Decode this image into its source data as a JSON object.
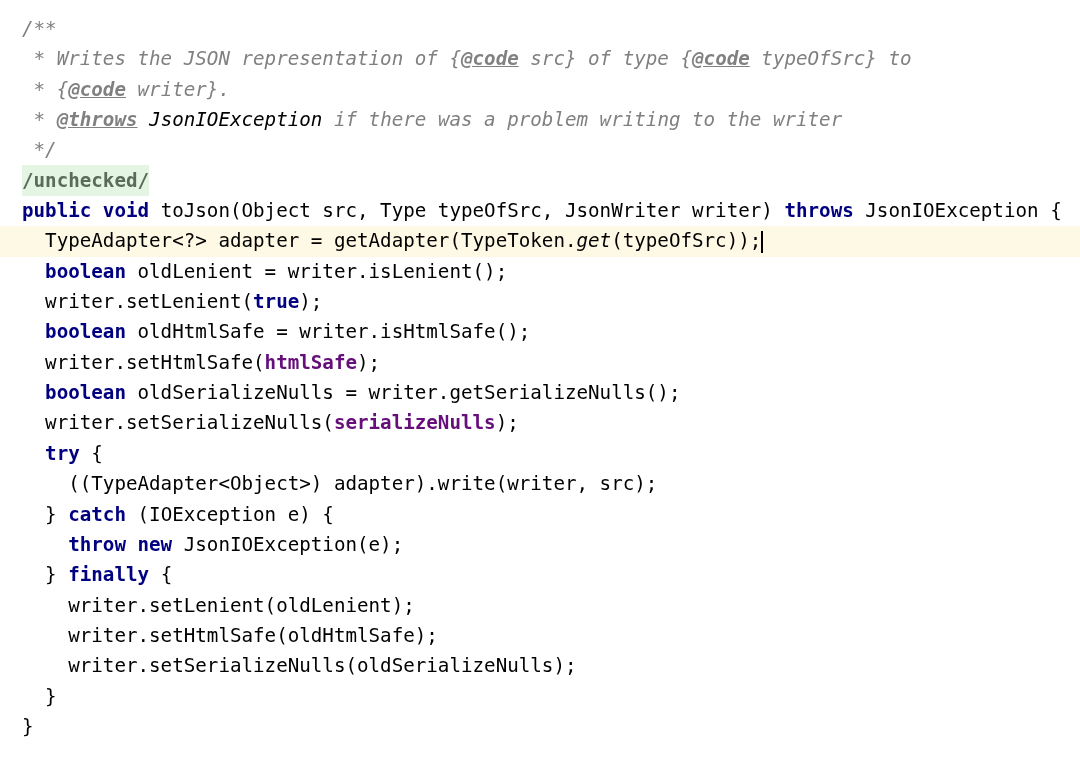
{
  "editor": {
    "lines": [
      {
        "current": false,
        "tokens": [
          {
            "kind": "comment",
            "text": "/**"
          }
        ]
      },
      {
        "current": false,
        "tokens": [
          {
            "kind": "comment",
            "text": " * Writes the JSON representation of {"
          },
          {
            "kind": "doctag",
            "text": "@code"
          },
          {
            "kind": "comment",
            "text": " src} of type {"
          },
          {
            "kind": "doctag",
            "text": "@code"
          },
          {
            "kind": "comment",
            "text": " typeOfSrc} to"
          }
        ]
      },
      {
        "current": false,
        "tokens": [
          {
            "kind": "comment",
            "text": " * {"
          },
          {
            "kind": "doctag",
            "text": "@code"
          },
          {
            "kind": "comment",
            "text": " writer}."
          }
        ]
      },
      {
        "current": false,
        "tokens": [
          {
            "kind": "comment",
            "text": " * "
          },
          {
            "kind": "doctag",
            "text": "@throws"
          },
          {
            "kind": "docref",
            "text": " JsonIOException"
          },
          {
            "kind": "comment",
            "text": " if there was a problem writing to the writer"
          }
        ]
      },
      {
        "current": false,
        "tokens": [
          {
            "kind": "comment",
            "text": " */"
          }
        ]
      },
      {
        "current": false,
        "tokens": [
          {
            "kind": "folded",
            "text": "/unchecked/"
          }
        ]
      },
      {
        "current": false,
        "tokens": [
          {
            "kind": "keyword",
            "text": "public void"
          },
          {
            "kind": "plain",
            "text": " toJson(Object src, Type typeOfSrc, JsonWriter writer) "
          },
          {
            "kind": "keyword",
            "text": "throws"
          },
          {
            "kind": "plain",
            "text": " JsonIOException {"
          }
        ]
      },
      {
        "current": true,
        "tokens": [
          {
            "kind": "plain",
            "text": "  TypeAdapter<?> adapter = getAdapter(TypeToken."
          },
          {
            "kind": "italic",
            "text": "get"
          },
          {
            "kind": "plain",
            "text": "(typeOfSrc));"
          }
        ]
      },
      {
        "current": false,
        "tokens": [
          {
            "kind": "keyword",
            "text": "  boolean"
          },
          {
            "kind": "plain",
            "text": " oldLenient = writer.isLenient();"
          }
        ]
      },
      {
        "current": false,
        "tokens": [
          {
            "kind": "plain",
            "text": "  writer.setLenient("
          },
          {
            "kind": "keyword",
            "text": "true"
          },
          {
            "kind": "plain",
            "text": ");"
          }
        ]
      },
      {
        "current": false,
        "tokens": [
          {
            "kind": "keyword",
            "text": "  boolean"
          },
          {
            "kind": "plain",
            "text": " oldHtmlSafe = writer.isHtmlSafe();"
          }
        ]
      },
      {
        "current": false,
        "tokens": [
          {
            "kind": "plain",
            "text": "  writer.setHtmlSafe("
          },
          {
            "kind": "field",
            "text": "htmlSafe"
          },
          {
            "kind": "plain",
            "text": ");"
          }
        ]
      },
      {
        "current": false,
        "tokens": [
          {
            "kind": "keyword",
            "text": "  boolean"
          },
          {
            "kind": "plain",
            "text": " oldSerializeNulls = writer.getSerializeNulls();"
          }
        ]
      },
      {
        "current": false,
        "tokens": [
          {
            "kind": "plain",
            "text": "  writer.setSerializeNulls("
          },
          {
            "kind": "field",
            "text": "serializeNulls"
          },
          {
            "kind": "plain",
            "text": ");"
          }
        ]
      },
      {
        "current": false,
        "tokens": [
          {
            "kind": "keyword",
            "text": "  try"
          },
          {
            "kind": "plain",
            "text": " {"
          }
        ]
      },
      {
        "current": false,
        "tokens": [
          {
            "kind": "plain",
            "text": "    ((TypeAdapter<Object>) adapter).write(writer, src);"
          }
        ]
      },
      {
        "current": false,
        "tokens": [
          {
            "kind": "plain",
            "text": "  } "
          },
          {
            "kind": "keyword",
            "text": "catch"
          },
          {
            "kind": "plain",
            "text": " (IOException e) {"
          }
        ]
      },
      {
        "current": false,
        "tokens": [
          {
            "kind": "keyword",
            "text": "    throw new"
          },
          {
            "kind": "plain",
            "text": " JsonIOException(e);"
          }
        ]
      },
      {
        "current": false,
        "tokens": [
          {
            "kind": "plain",
            "text": "  } "
          },
          {
            "kind": "keyword",
            "text": "finally"
          },
          {
            "kind": "plain",
            "text": " {"
          }
        ]
      },
      {
        "current": false,
        "tokens": [
          {
            "kind": "plain",
            "text": "    writer.setLenient(oldLenient);"
          }
        ]
      },
      {
        "current": false,
        "tokens": [
          {
            "kind": "plain",
            "text": "    writer.setHtmlSafe(oldHtmlSafe);"
          }
        ]
      },
      {
        "current": false,
        "tokens": [
          {
            "kind": "plain",
            "text": "    writer.setSerializeNulls(oldSerializeNulls);"
          }
        ]
      },
      {
        "current": false,
        "tokens": [
          {
            "kind": "plain",
            "text": "  }"
          }
        ]
      },
      {
        "current": false,
        "tokens": [
          {
            "kind": "plain",
            "text": "}"
          }
        ]
      }
    ]
  }
}
